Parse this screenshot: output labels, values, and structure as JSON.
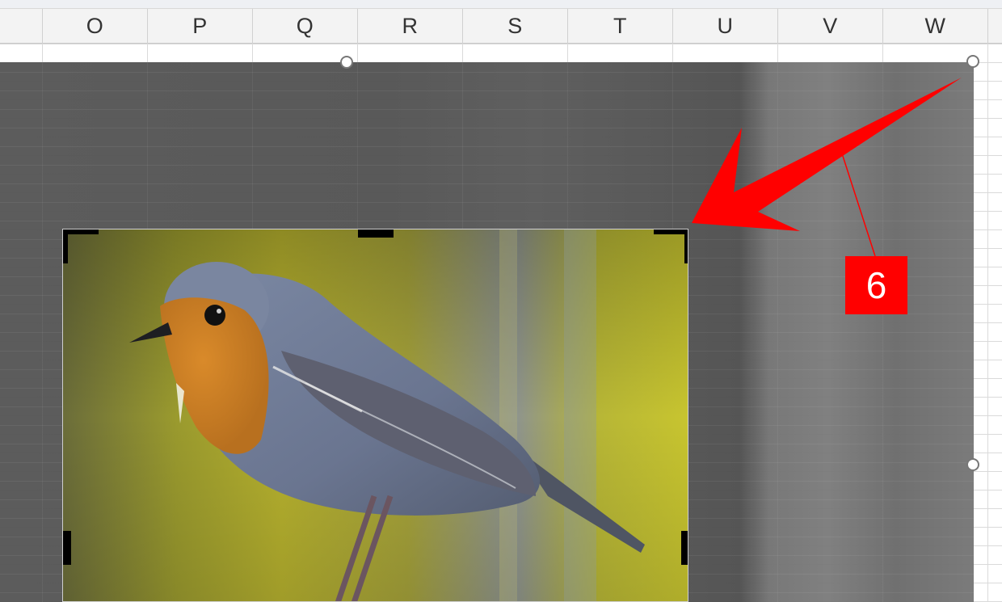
{
  "columns": [
    "O",
    "P",
    "Q",
    "R",
    "S",
    "T",
    "U",
    "V",
    "W"
  ],
  "callout": {
    "number": "6"
  },
  "colors": {
    "annotation_red": "#ff0000",
    "selection_handle": "#ffffff",
    "crop_mark": "#000000"
  },
  "icons": {
    "arrow": "red-arrow-icon"
  },
  "image": {
    "subject": "bird-on-branch"
  }
}
